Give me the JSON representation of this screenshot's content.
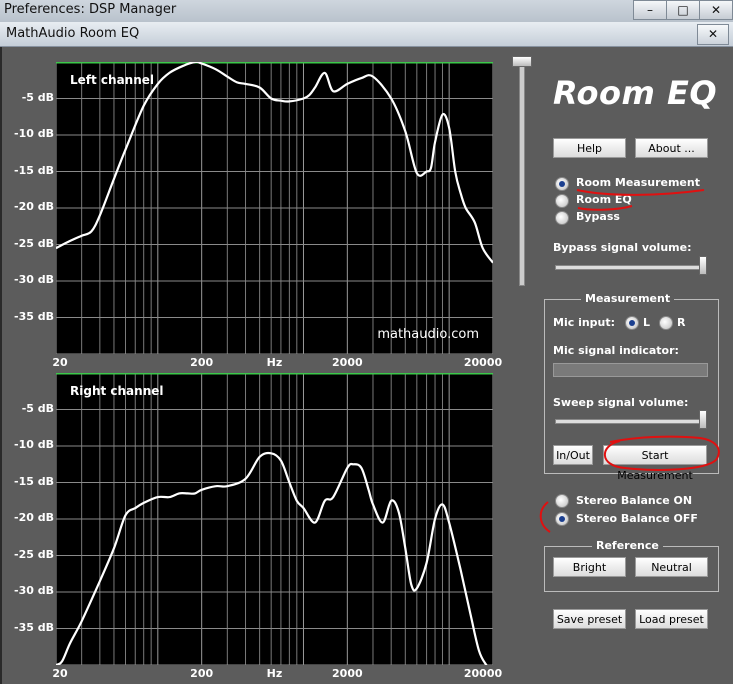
{
  "window": {
    "outer_title": "Preferences: DSP Manager",
    "inner_title": "MathAudio Room EQ",
    "close_glyph": "✕"
  },
  "brand": "Room EQ",
  "plots": {
    "left": {
      "title": "Left channel",
      "watermark": "mathaudio.com",
      "yticks": [
        "-5 dB",
        "-10 dB",
        "-15 dB",
        "-20 dB",
        "-25 dB",
        "-30 dB",
        "-35 dB"
      ],
      "xticks": [
        "20",
        "200",
        "Hz",
        "2000",
        "20000"
      ]
    },
    "right": {
      "title": "Right channel",
      "yticks": [
        "-5 dB",
        "-10 dB",
        "-15 dB",
        "-20 dB",
        "-25 dB",
        "-30 dB",
        "-35 dB"
      ],
      "xticks": [
        "20",
        "200",
        "Hz",
        "2000",
        "20000"
      ]
    }
  },
  "buttons": {
    "help": "Help",
    "about": "About ...",
    "in_out": "In/Out",
    "start_measurement": "Start Measurement",
    "bright": "Bright",
    "neutral": "Neutral",
    "save_preset": "Save preset",
    "load_preset": "Load preset"
  },
  "modes": {
    "selected": "Room Measurement",
    "options": [
      "Room Measurement",
      "Room EQ",
      "Bypass"
    ]
  },
  "bypass_volume": {
    "label": "Bypass signal volume:",
    "value": 1.0
  },
  "measurement": {
    "title": "Measurement",
    "mic_input_label": "Mic input:",
    "mic_options": [
      "L",
      "R"
    ],
    "mic_selected": "L",
    "mic_indicator_label": "Mic signal indicator:",
    "sweep_label": "Sweep signal volume:",
    "sweep_value": 1.0
  },
  "stereo_balance": {
    "options": [
      "Stereo Balance ON",
      "Stereo Balance OFF"
    ],
    "selected": "Stereo Balance OFF"
  },
  "reference": {
    "title": "Reference"
  },
  "chart_data": [
    {
      "type": "line",
      "title": "Left channel",
      "xscale": "log",
      "xlim": [
        20,
        20000
      ],
      "ylim": [
        -40,
        0
      ],
      "grid": true,
      "series": [
        {
          "x": [
            20,
            25,
            30,
            35,
            40,
            50,
            60,
            80,
            100,
            120,
            150,
            180,
            200,
            250,
            300,
            350,
            400,
            500,
            600,
            700,
            800,
            1000,
            1100,
            1200,
            1400,
            1600,
            2000,
            2500,
            3000,
            4000,
            5000,
            6000,
            7000,
            7500,
            8000,
            9000,
            10000,
            11000,
            12000,
            13000,
            15000,
            17000,
            20000
          ],
          "y": [
            -25.5,
            -24.5,
            -23.8,
            -23.2,
            -21,
            -16,
            -12,
            -6,
            -3,
            -1.5,
            -0.5,
            0,
            -0.2,
            -1,
            -2,
            -2.8,
            -3,
            -3.5,
            -5,
            -5.3,
            -5.4,
            -5,
            -4.5,
            -3.5,
            -1.5,
            -4,
            -3,
            -2.2,
            -2,
            -5,
            -9.5,
            -15.2,
            -15,
            -14.5,
            -11,
            -7.2,
            -9,
            -15,
            -18,
            -20,
            -22,
            -25.5,
            -27.5
          ]
        }
      ]
    },
    {
      "type": "line",
      "title": "Right channel",
      "xscale": "log",
      "xlim": [
        20,
        20000
      ],
      "ylim": [
        -40,
        0
      ],
      "grid": true,
      "series": [
        {
          "x": [
            20,
            22,
            25,
            30,
            40,
            50,
            60,
            70,
            80,
            100,
            120,
            140,
            160,
            180,
            200,
            250,
            300,
            400,
            500,
            600,
            700,
            800,
            900,
            1000,
            1200,
            1400,
            1600,
            2000,
            2200,
            2500,
            2800,
            3000,
            3500,
            4000,
            4500,
            5000,
            5500,
            6000,
            7000,
            8000,
            9000,
            10000,
            12000,
            14000,
            16000,
            18000,
            20000
          ],
          "y": [
            -40,
            -39.5,
            -37,
            -34,
            -28.5,
            -24,
            -19.5,
            -18.5,
            -17.8,
            -17,
            -17,
            -16.5,
            -16.5,
            -16.5,
            -16,
            -15.5,
            -15.5,
            -14.5,
            -11.5,
            -11,
            -12,
            -15,
            -17.5,
            -18.5,
            -20.5,
            -17.5,
            -17,
            -13,
            -12.5,
            -13,
            -16,
            -18,
            -20.5,
            -17.5,
            -19,
            -24,
            -29,
            -29.5,
            -26,
            -20,
            -18,
            -20.5,
            -27,
            -33,
            -38,
            -40,
            -41
          ]
        }
      ]
    }
  ]
}
